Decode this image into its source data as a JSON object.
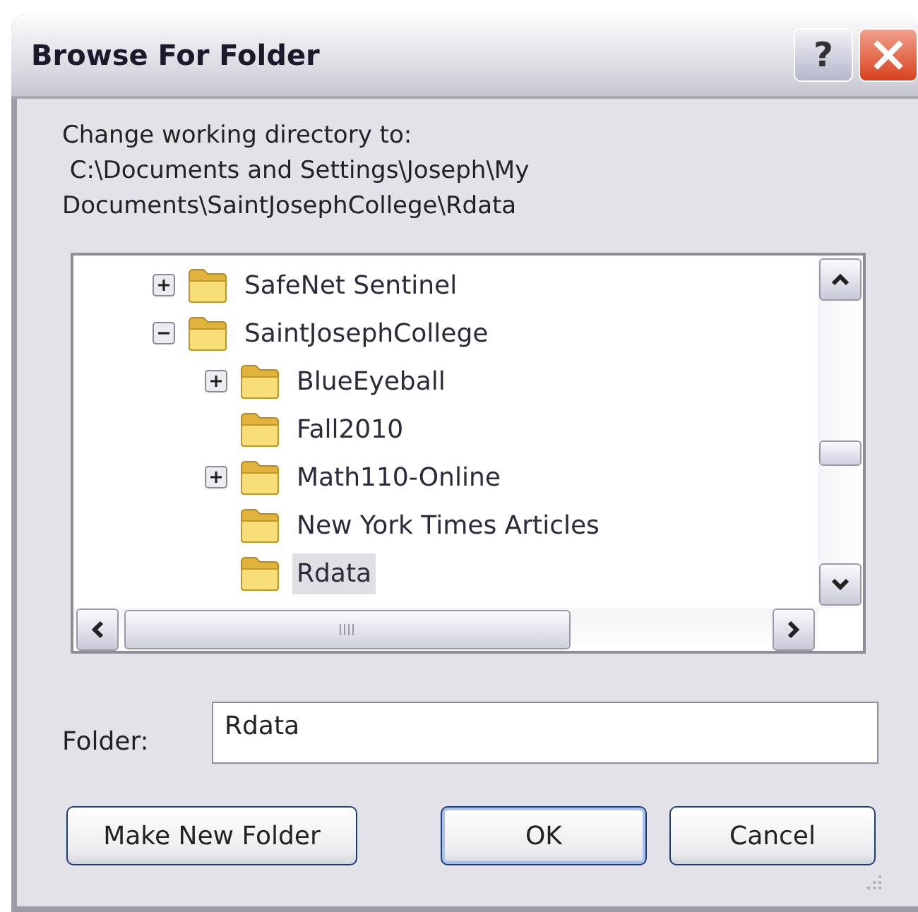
{
  "window": {
    "title": "Browse For Folder",
    "buttons": [
      {
        "kind": "help",
        "label": "?"
      },
      {
        "kind": "close"
      }
    ]
  },
  "description": "Change working directory to:\n C:\\Documents and Settings\\Joseph\\My\nDocuments\\SaintJosephCollege\\Rdata",
  "tree": {
    "items": [
      {
        "label": "SafeNet Sentinel",
        "expanded": false,
        "selected": false
      },
      {
        "label": "SaintJosephCollege",
        "expanded": true,
        "selected": false,
        "children": [
          {
            "label": "BlueEyeball",
            "expanded": false,
            "selected": false
          },
          {
            "label": "Fall2010",
            "selected": false
          },
          {
            "label": "Math110-Online",
            "expanded": false,
            "selected": false
          },
          {
            "label": "New York Times Articles",
            "selected": false
          },
          {
            "label": "Rdata",
            "selected": true
          }
        ]
      }
    ]
  },
  "folder": {
    "label": "Folder:",
    "value": "Rdata"
  },
  "buttons": [
    {
      "label": "Make New Folder",
      "default": false
    },
    {
      "label": "OK",
      "default": true
    },
    {
      "label": "Cancel",
      "default": false
    }
  ]
}
